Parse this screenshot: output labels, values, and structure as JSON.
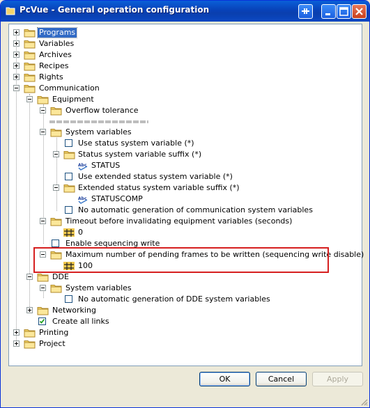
{
  "window": {
    "title": "PcVue - General operation configuration"
  },
  "tree": {
    "programs": "Programs",
    "variables": "Variables",
    "archives": "Archives",
    "recipes": "Recipes",
    "rights": "Rights",
    "communication": "Communication",
    "equipment": "Equipment",
    "overflow_tolerance": "Overflow tolerance",
    "system_variables": "System variables",
    "use_status_system_variable": "Use status system variable (*)",
    "status_suffix": "Status system variable suffix (*)",
    "status_value": "STATUS",
    "use_extended_status": "Use extended status system variable (*)",
    "extended_suffix": "Extended status system variable suffix (*)",
    "extended_value": "STATUSCOMP",
    "no_auto_comm_sysvars": "No automatic generation of communication system variables",
    "timeout": "Timeout before invalidating equipment variables (seconds)",
    "timeout_value": "0",
    "enable_seq_write": "Enable sequencing write",
    "max_pending_frames": "Maximum number of pending frames to be written (sequencing write disable)",
    "max_pending_value": "100",
    "dde": "DDE",
    "dde_system_variables": "System variables",
    "no_auto_dde_sysvars": "No automatic generation of DDE system variables",
    "networking": "Networking",
    "create_all_links": "Create all links",
    "printing": "Printing",
    "project": "Project"
  },
  "buttons": {
    "ok": "OK",
    "cancel": "Cancel",
    "apply": "Apply"
  },
  "colors": {
    "titlebar": "#0a5fd8",
    "selection": "#316ac5",
    "highlight_box": "#d61f1f",
    "folder": "#f3d46a"
  }
}
